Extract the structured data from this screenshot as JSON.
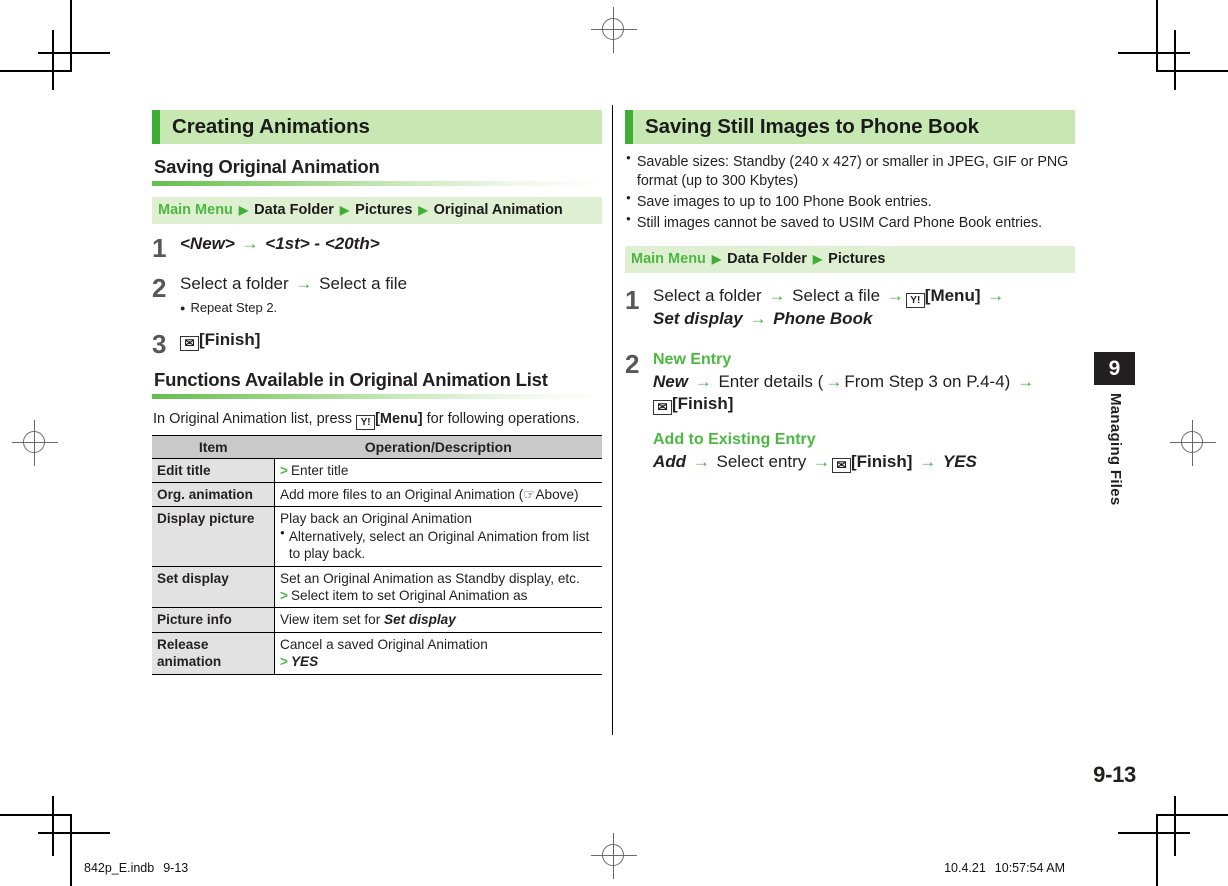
{
  "page": {
    "folio": "9-13",
    "chapter_number": "9",
    "chapter_title": "Managing Files"
  },
  "footer": {
    "file_name": "842p_E.indb",
    "page_ref": "9-13",
    "date": "10.4.21",
    "time": "10:57:54 AM"
  },
  "left_column": {
    "section_title": "Creating Animations",
    "sub_title": "Saving Original Animation",
    "path": {
      "root": "Main Menu",
      "items": [
        "Data Folder",
        "Pictures",
        "Original Animation"
      ]
    },
    "steps": [
      {
        "number": "1",
        "parts": [
          {
            "text": "<New>",
            "style": "bold-italic"
          },
          {
            "text": "→",
            "style": "arrow"
          },
          {
            "text": "<1st> - <20th>",
            "style": "bold-italic"
          }
        ]
      },
      {
        "number": "2",
        "parts": [
          {
            "text": "Select a folder",
            "style": "plain"
          },
          {
            "text": "→",
            "style": "arrow"
          },
          {
            "text": "Select a file",
            "style": "plain"
          }
        ],
        "note": "Repeat Step 2."
      },
      {
        "number": "3",
        "parts": [
          {
            "text": "envelope-key-icon",
            "style": "key-icon"
          },
          {
            "text": "[Finish]",
            "style": "bold"
          }
        ]
      }
    ],
    "functions_title": "Functions Available in Original Animation List",
    "intro_before": "In Original Animation list, press ",
    "intro_key": "Y!",
    "intro_after_bold": "[Menu]",
    "intro_end": " for following operations.",
    "table": {
      "headers": [
        "Item",
        "Operation/Description"
      ],
      "rows": [
        {
          "item": "Edit title",
          "lines": [
            {
              "marker": "gt",
              "text": "Enter title"
            }
          ]
        },
        {
          "item": "Org. animation",
          "lines": [
            {
              "marker": "none",
              "text": "Add more files to an Original Animation (☞Above)"
            }
          ]
        },
        {
          "item": "Display picture",
          "lines": [
            {
              "marker": "none",
              "text": "Play back an Original Animation"
            },
            {
              "marker": "dot",
              "text": "Alternatively, select an Original Animation from list to play back."
            }
          ]
        },
        {
          "item": "Set display",
          "lines": [
            {
              "marker": "none",
              "text": "Set an Original Animation as Standby display, etc."
            },
            {
              "marker": "gt",
              "text": "Select item to set Original Animation as"
            }
          ]
        },
        {
          "item": "Picture info",
          "lines": [
            {
              "marker": "none",
              "text": "View item set for ",
              "suffix_bold_italic": "Set display"
            }
          ]
        },
        {
          "item": "Release animation",
          "lines": [
            {
              "marker": "none",
              "text": "Cancel a saved Original Animation"
            },
            {
              "marker": "gt",
              "text": "YES",
              "style": "bold-italic"
            }
          ]
        }
      ]
    }
  },
  "right_column": {
    "section_title": "Saving Still Images to Phone Book",
    "bullets": [
      "Savable sizes: Standby (240 x 427) or smaller in JPEG, GIF or PNG format (up to 300 Kbytes)",
      "Save images to up to 100 Phone Book entries.",
      "Still images cannot be saved to USIM Card Phone Book entries."
    ],
    "path": {
      "root": "Main Menu",
      "items": [
        "Data Folder",
        "Pictures"
      ]
    },
    "step1": {
      "number": "1",
      "line1_a": "Select a folder",
      "line1_b": "Select a file",
      "line1_key": "Y!",
      "line1_menu": "[Menu]",
      "line2_a": "Set display",
      "line2_b": "Phone Book"
    },
    "step2": {
      "number": "2",
      "group1_label": "New Entry",
      "group1_new": "New",
      "group1_mid": "Enter details (",
      "group1_ref": "From Step 3 on P.4-4",
      "group1_close": ")",
      "group1_finish": "[Finish]",
      "group2_label": "Add to Existing Entry",
      "group2_add": "Add",
      "group2_select": "Select entry",
      "group2_finish": "[Finish]",
      "group2_yes": "YES"
    }
  },
  "icons": {
    "envelope": "✉",
    "yahoo_key": "Y!",
    "arrow": "→",
    "triangle": "▶",
    "bullet": "●",
    "gt": ">",
    "hand": "☞"
  },
  "colors": {
    "accent_green": "#4cb842",
    "bar_green": "#3fae35",
    "header_bg": "#c7e8b2",
    "path_bg": "#dff0d2",
    "table_header_bg": "#c9c9c9",
    "table_item_bg": "#e2e2e2",
    "tab_black": "#231f20"
  }
}
